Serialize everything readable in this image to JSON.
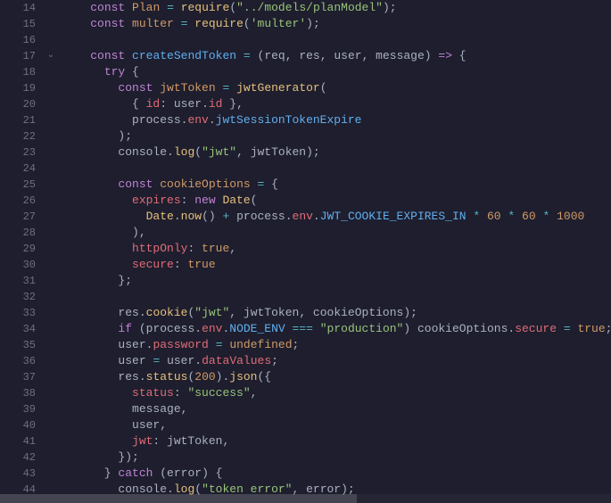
{
  "lines": [
    {
      "num": "14",
      "fold": "",
      "tokens": [
        {
          "t": "    ",
          "c": "pun"
        },
        {
          "t": "const",
          "c": "kw"
        },
        {
          "t": " ",
          "c": "pun"
        },
        {
          "t": "Plan",
          "c": "const"
        },
        {
          "t": " ",
          "c": "pun"
        },
        {
          "t": "=",
          "c": "op"
        },
        {
          "t": " ",
          "c": "pun"
        },
        {
          "t": "require",
          "c": "fn"
        },
        {
          "t": "(",
          "c": "pun"
        },
        {
          "t": "\"../models/planModel\"",
          "c": "str"
        },
        {
          "t": ");",
          "c": "pun"
        }
      ]
    },
    {
      "num": "15",
      "fold": "",
      "tokens": [
        {
          "t": "    ",
          "c": "pun"
        },
        {
          "t": "const",
          "c": "kw"
        },
        {
          "t": " ",
          "c": "pun"
        },
        {
          "t": "multer",
          "c": "const"
        },
        {
          "t": " ",
          "c": "pun"
        },
        {
          "t": "=",
          "c": "op"
        },
        {
          "t": " ",
          "c": "pun"
        },
        {
          "t": "require",
          "c": "fn"
        },
        {
          "t": "(",
          "c": "pun"
        },
        {
          "t": "'multer'",
          "c": "str"
        },
        {
          "t": ");",
          "c": "pun"
        }
      ]
    },
    {
      "num": "16",
      "fold": "",
      "tokens": []
    },
    {
      "num": "17",
      "fold": "⌄",
      "tokens": [
        {
          "t": "    ",
          "c": "pun"
        },
        {
          "t": "const",
          "c": "kw"
        },
        {
          "t": " ",
          "c": "pun"
        },
        {
          "t": "createSendToken",
          "c": "def"
        },
        {
          "t": " ",
          "c": "pun"
        },
        {
          "t": "=",
          "c": "op"
        },
        {
          "t": " (",
          "c": "pun"
        },
        {
          "t": "req",
          "c": "param"
        },
        {
          "t": ", ",
          "c": "pun"
        },
        {
          "t": "res",
          "c": "param"
        },
        {
          "t": ", ",
          "c": "pun"
        },
        {
          "t": "user",
          "c": "param"
        },
        {
          "t": ", ",
          "c": "pun"
        },
        {
          "t": "message",
          "c": "param"
        },
        {
          "t": ") ",
          "c": "pun"
        },
        {
          "t": "=>",
          "c": "kw"
        },
        {
          "t": " {",
          "c": "pun"
        }
      ]
    },
    {
      "num": "18",
      "fold": "",
      "tokens": [
        {
          "t": "      ",
          "c": "pun"
        },
        {
          "t": "try",
          "c": "kw"
        },
        {
          "t": " {",
          "c": "pun"
        }
      ]
    },
    {
      "num": "19",
      "fold": "",
      "tokens": [
        {
          "t": "        ",
          "c": "pun"
        },
        {
          "t": "const",
          "c": "kw"
        },
        {
          "t": " ",
          "c": "pun"
        },
        {
          "t": "jwtToken",
          "c": "const"
        },
        {
          "t": " ",
          "c": "pun"
        },
        {
          "t": "=",
          "c": "op"
        },
        {
          "t": " ",
          "c": "pun"
        },
        {
          "t": "jwtGenerator",
          "c": "fn"
        },
        {
          "t": "(",
          "c": "pun"
        }
      ]
    },
    {
      "num": "20",
      "fold": "",
      "tokens": [
        {
          "t": "          { ",
          "c": "pun"
        },
        {
          "t": "id",
          "c": "prop2"
        },
        {
          "t": ": ",
          "c": "pun"
        },
        {
          "t": "user",
          "c": "ident"
        },
        {
          "t": ".",
          "c": "pun"
        },
        {
          "t": "id",
          "c": "prop2"
        },
        {
          "t": " },",
          "c": "pun"
        }
      ]
    },
    {
      "num": "21",
      "fold": "",
      "tokens": [
        {
          "t": "          ",
          "c": "pun"
        },
        {
          "t": "process",
          "c": "ident"
        },
        {
          "t": ".",
          "c": "pun"
        },
        {
          "t": "env",
          "c": "prop2"
        },
        {
          "t": ".",
          "c": "pun"
        },
        {
          "t": "jwtSessionTokenExpire",
          "c": "def"
        }
      ]
    },
    {
      "num": "22",
      "fold": "",
      "tokens": [
        {
          "t": "        );",
          "c": "pun"
        }
      ]
    },
    {
      "num": "23",
      "fold": "",
      "tokens": [
        {
          "t": "        ",
          "c": "pun"
        },
        {
          "t": "console",
          "c": "ident"
        },
        {
          "t": ".",
          "c": "pun"
        },
        {
          "t": "log",
          "c": "fn"
        },
        {
          "t": "(",
          "c": "pun"
        },
        {
          "t": "\"jwt\"",
          "c": "str"
        },
        {
          "t": ", ",
          "c": "pun"
        },
        {
          "t": "jwtToken",
          "c": "ident"
        },
        {
          "t": ");",
          "c": "pun"
        }
      ]
    },
    {
      "num": "24",
      "fold": "",
      "tokens": []
    },
    {
      "num": "25",
      "fold": "",
      "tokens": [
        {
          "t": "        ",
          "c": "pun"
        },
        {
          "t": "const",
          "c": "kw"
        },
        {
          "t": " ",
          "c": "pun"
        },
        {
          "t": "cookieOptions",
          "c": "const"
        },
        {
          "t": " ",
          "c": "pun"
        },
        {
          "t": "=",
          "c": "op"
        },
        {
          "t": " {",
          "c": "pun"
        }
      ]
    },
    {
      "num": "26",
      "fold": "",
      "tokens": [
        {
          "t": "          ",
          "c": "pun"
        },
        {
          "t": "expires",
          "c": "prop2"
        },
        {
          "t": ": ",
          "c": "pun"
        },
        {
          "t": "new",
          "c": "kw"
        },
        {
          "t": " ",
          "c": "pun"
        },
        {
          "t": "Date",
          "c": "fn"
        },
        {
          "t": "(",
          "c": "pun"
        }
      ]
    },
    {
      "num": "27",
      "fold": "",
      "tokens": [
        {
          "t": "            ",
          "c": "pun"
        },
        {
          "t": "Date",
          "c": "fn"
        },
        {
          "t": ".",
          "c": "pun"
        },
        {
          "t": "now",
          "c": "fn"
        },
        {
          "t": "() ",
          "c": "pun"
        },
        {
          "t": "+",
          "c": "op"
        },
        {
          "t": " ",
          "c": "pun"
        },
        {
          "t": "process",
          "c": "ident"
        },
        {
          "t": ".",
          "c": "pun"
        },
        {
          "t": "env",
          "c": "prop2"
        },
        {
          "t": ".",
          "c": "pun"
        },
        {
          "t": "JWT_COOKIE_EXPIRES_IN",
          "c": "def"
        },
        {
          "t": " ",
          "c": "pun"
        },
        {
          "t": "*",
          "c": "op"
        },
        {
          "t": " ",
          "c": "pun"
        },
        {
          "t": "60",
          "c": "num"
        },
        {
          "t": " ",
          "c": "pun"
        },
        {
          "t": "*",
          "c": "op"
        },
        {
          "t": " ",
          "c": "pun"
        },
        {
          "t": "60",
          "c": "num"
        },
        {
          "t": " ",
          "c": "pun"
        },
        {
          "t": "*",
          "c": "op"
        },
        {
          "t": " ",
          "c": "pun"
        },
        {
          "t": "1000",
          "c": "num"
        }
      ]
    },
    {
      "num": "28",
      "fold": "",
      "tokens": [
        {
          "t": "          ),",
          "c": "pun"
        }
      ]
    },
    {
      "num": "29",
      "fold": "",
      "tokens": [
        {
          "t": "          ",
          "c": "pun"
        },
        {
          "t": "httpOnly",
          "c": "prop2"
        },
        {
          "t": ": ",
          "c": "pun"
        },
        {
          "t": "true",
          "c": "bool"
        },
        {
          "t": ",",
          "c": "pun"
        }
      ]
    },
    {
      "num": "30",
      "fold": "",
      "tokens": [
        {
          "t": "          ",
          "c": "pun"
        },
        {
          "t": "secure",
          "c": "prop2"
        },
        {
          "t": ": ",
          "c": "pun"
        },
        {
          "t": "true",
          "c": "bool"
        }
      ]
    },
    {
      "num": "31",
      "fold": "",
      "tokens": [
        {
          "t": "        };",
          "c": "pun"
        }
      ]
    },
    {
      "num": "32",
      "fold": "",
      "tokens": []
    },
    {
      "num": "33",
      "fold": "",
      "tokens": [
        {
          "t": "        ",
          "c": "pun"
        },
        {
          "t": "res",
          "c": "ident"
        },
        {
          "t": ".",
          "c": "pun"
        },
        {
          "t": "cookie",
          "c": "fn"
        },
        {
          "t": "(",
          "c": "pun"
        },
        {
          "t": "\"jwt\"",
          "c": "str"
        },
        {
          "t": ", ",
          "c": "pun"
        },
        {
          "t": "jwtToken",
          "c": "ident"
        },
        {
          "t": ", ",
          "c": "pun"
        },
        {
          "t": "cookieOptions",
          "c": "ident"
        },
        {
          "t": ");",
          "c": "pun"
        }
      ]
    },
    {
      "num": "34",
      "fold": "",
      "tokens": [
        {
          "t": "        ",
          "c": "pun"
        },
        {
          "t": "if",
          "c": "kw"
        },
        {
          "t": " (",
          "c": "pun"
        },
        {
          "t": "process",
          "c": "ident"
        },
        {
          "t": ".",
          "c": "pun"
        },
        {
          "t": "env",
          "c": "prop2"
        },
        {
          "t": ".",
          "c": "pun"
        },
        {
          "t": "NODE_ENV",
          "c": "def"
        },
        {
          "t": " ",
          "c": "pun"
        },
        {
          "t": "===",
          "c": "op"
        },
        {
          "t": " ",
          "c": "pun"
        },
        {
          "t": "\"production\"",
          "c": "str"
        },
        {
          "t": ") ",
          "c": "pun"
        },
        {
          "t": "cookieOptions",
          "c": "ident"
        },
        {
          "t": ".",
          "c": "pun"
        },
        {
          "t": "secure",
          "c": "prop2"
        },
        {
          "t": " ",
          "c": "pun"
        },
        {
          "t": "=",
          "c": "op"
        },
        {
          "t": " ",
          "c": "pun"
        },
        {
          "t": "true",
          "c": "bool"
        },
        {
          "t": ";",
          "c": "pun"
        }
      ]
    },
    {
      "num": "35",
      "fold": "",
      "tokens": [
        {
          "t": "        ",
          "c": "pun"
        },
        {
          "t": "user",
          "c": "ident"
        },
        {
          "t": ".",
          "c": "pun"
        },
        {
          "t": "password",
          "c": "prop2"
        },
        {
          "t": " ",
          "c": "pun"
        },
        {
          "t": "=",
          "c": "op"
        },
        {
          "t": " ",
          "c": "pun"
        },
        {
          "t": "undefined",
          "c": "bool"
        },
        {
          "t": ";",
          "c": "pun"
        }
      ]
    },
    {
      "num": "36",
      "fold": "",
      "tokens": [
        {
          "t": "        ",
          "c": "pun"
        },
        {
          "t": "user",
          "c": "ident"
        },
        {
          "t": " ",
          "c": "pun"
        },
        {
          "t": "=",
          "c": "op"
        },
        {
          "t": " ",
          "c": "pun"
        },
        {
          "t": "user",
          "c": "ident"
        },
        {
          "t": ".",
          "c": "pun"
        },
        {
          "t": "dataValues",
          "c": "prop2"
        },
        {
          "t": ";",
          "c": "pun"
        }
      ]
    },
    {
      "num": "37",
      "fold": "",
      "tokens": [
        {
          "t": "        ",
          "c": "pun"
        },
        {
          "t": "res",
          "c": "ident"
        },
        {
          "t": ".",
          "c": "pun"
        },
        {
          "t": "status",
          "c": "fn"
        },
        {
          "t": "(",
          "c": "pun"
        },
        {
          "t": "200",
          "c": "num"
        },
        {
          "t": ").",
          "c": "pun"
        },
        {
          "t": "json",
          "c": "fn"
        },
        {
          "t": "({",
          "c": "pun"
        }
      ]
    },
    {
      "num": "38",
      "fold": "",
      "tokens": [
        {
          "t": "          ",
          "c": "pun"
        },
        {
          "t": "status",
          "c": "prop2"
        },
        {
          "t": ": ",
          "c": "pun"
        },
        {
          "t": "\"success\"",
          "c": "str"
        },
        {
          "t": ",",
          "c": "pun"
        }
      ]
    },
    {
      "num": "39",
      "fold": "",
      "tokens": [
        {
          "t": "          ",
          "c": "pun"
        },
        {
          "t": "message",
          "c": "ident"
        },
        {
          "t": ",",
          "c": "pun"
        }
      ]
    },
    {
      "num": "40",
      "fold": "",
      "tokens": [
        {
          "t": "          ",
          "c": "pun"
        },
        {
          "t": "user",
          "c": "ident"
        },
        {
          "t": ",",
          "c": "pun"
        }
      ]
    },
    {
      "num": "41",
      "fold": "",
      "tokens": [
        {
          "t": "          ",
          "c": "pun"
        },
        {
          "t": "jwt",
          "c": "prop2"
        },
        {
          "t": ": ",
          "c": "pun"
        },
        {
          "t": "jwtToken",
          "c": "ident"
        },
        {
          "t": ",",
          "c": "pun"
        }
      ]
    },
    {
      "num": "42",
      "fold": "",
      "tokens": [
        {
          "t": "        });",
          "c": "pun"
        }
      ]
    },
    {
      "num": "43",
      "fold": "",
      "tokens": [
        {
          "t": "      } ",
          "c": "pun"
        },
        {
          "t": "catch",
          "c": "kw"
        },
        {
          "t": " (",
          "c": "pun"
        },
        {
          "t": "error",
          "c": "param"
        },
        {
          "t": ") {",
          "c": "pun"
        }
      ]
    },
    {
      "num": "44",
      "fold": "",
      "tokens": [
        {
          "t": "        ",
          "c": "pun"
        },
        {
          "t": "console",
          "c": "ident"
        },
        {
          "t": ".",
          "c": "pun"
        },
        {
          "t": "log",
          "c": "fn"
        },
        {
          "t": "(",
          "c": "pun"
        },
        {
          "t": "\"token error\"",
          "c": "str"
        },
        {
          "t": ", ",
          "c": "pun"
        },
        {
          "t": "error",
          "c": "ident"
        },
        {
          "t": ");",
          "c": "pun"
        }
      ]
    }
  ]
}
